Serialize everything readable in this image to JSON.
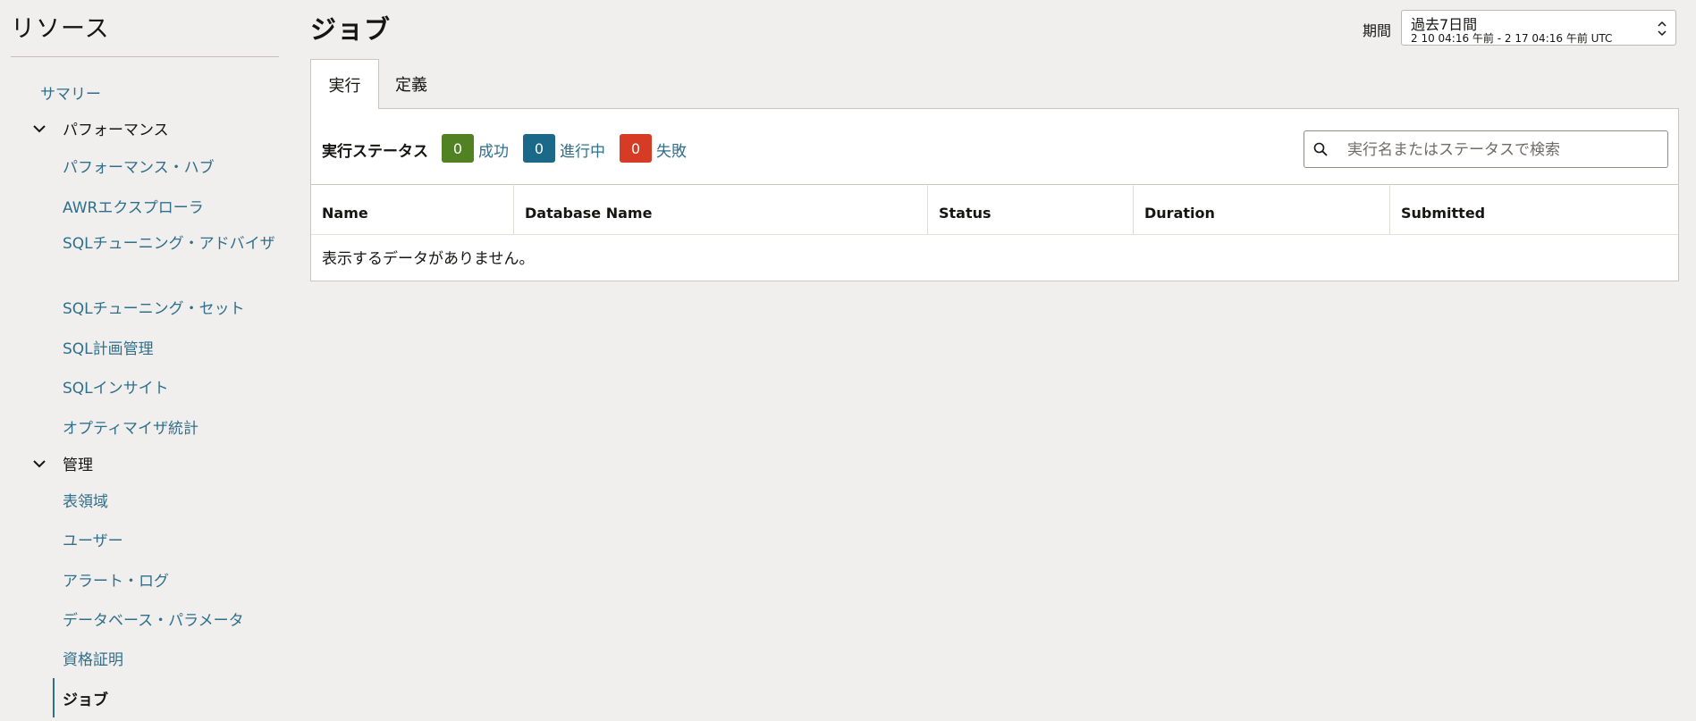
{
  "sidebar": {
    "title": "リソース",
    "summary": "サマリー",
    "performance_group": "パフォーマンス",
    "performance_items": [
      "パフォーマンス・ハブ",
      "AWRエクスプローラ",
      "SQLチューニング・アドバイザ",
      "SQLチューニング・セット",
      "SQL計画管理",
      "SQLインサイト",
      "オプティマイザ統計"
    ],
    "admin_group": "管理",
    "admin_items": [
      "表領域",
      "ユーザー",
      "アラート・ログ",
      "データベース・パラメータ",
      "資格証明",
      "ジョブ"
    ],
    "active_item": "ジョブ"
  },
  "header": {
    "title": "ジョブ",
    "period_label": "期間",
    "period_value": "過去7日間",
    "period_range": "2 10 04:16 午前 - 2 17 04:16 午前 UTC"
  },
  "tabs": [
    {
      "label": "実行",
      "active": true
    },
    {
      "label": "定義",
      "active": false
    }
  ],
  "status": {
    "title": "実行ステータス",
    "items": [
      {
        "count": "0",
        "label": "成功",
        "color": "#508223"
      },
      {
        "count": "0",
        "label": "進行中",
        "color": "#1b6988"
      },
      {
        "count": "0",
        "label": "失敗",
        "color": "#d63b25"
      }
    ]
  },
  "search": {
    "placeholder": "実行名またはステータスで検索"
  },
  "table": {
    "columns": [
      "Name",
      "Database Name",
      "Status",
      "Duration",
      "Submitted"
    ],
    "empty_message": "表示するデータがありません。"
  },
  "icons": {
    "chevron": "chevron-down-icon",
    "search": "search-icon",
    "select_arrows": "select-arrows-icon"
  }
}
